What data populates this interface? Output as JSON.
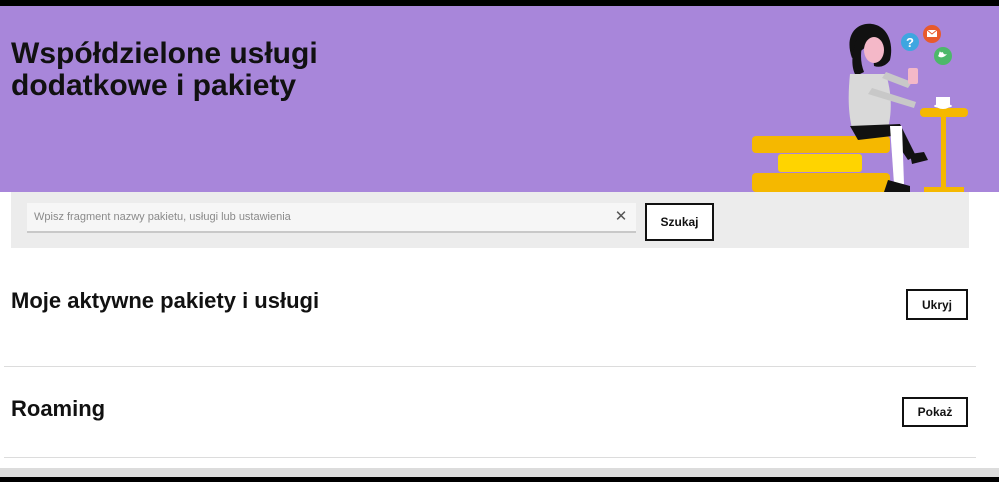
{
  "hero": {
    "title": "Współdzielone usługi dodatkowe i pakiety",
    "background_color": "#a886da"
  },
  "search": {
    "placeholder": "Wpisz fragment nazwy pakietu, usługi lub ustawienia",
    "value": "",
    "clear_icon": "close-icon",
    "button_label": "Szukaj"
  },
  "sections": [
    {
      "title": "Moje aktywne pakiety i usługi",
      "button_label": "Ukryj"
    },
    {
      "title": "Roaming",
      "button_label": "Pokaż"
    }
  ],
  "colors": {
    "accent_yellow": "#f5b800",
    "light_yellow": "#ffd400",
    "band_gray": "#ececec"
  }
}
